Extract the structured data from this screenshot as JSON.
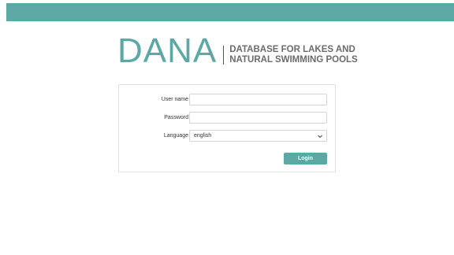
{
  "branding": {
    "logo_text": "DANA",
    "tagline_line1": "DATABASE FOR LAKES AND",
    "tagline_line2": "NATURAL SWIMMING POOLS"
  },
  "login_form": {
    "username_label": "User name",
    "username_value": "",
    "password_label": "Password",
    "password_value": "",
    "language_label": "Language",
    "language_selected": "english",
    "submit_label": "Login"
  },
  "colors": {
    "accent": "#5ba8a4",
    "border": "#e2e2e2",
    "text": "#333333"
  }
}
